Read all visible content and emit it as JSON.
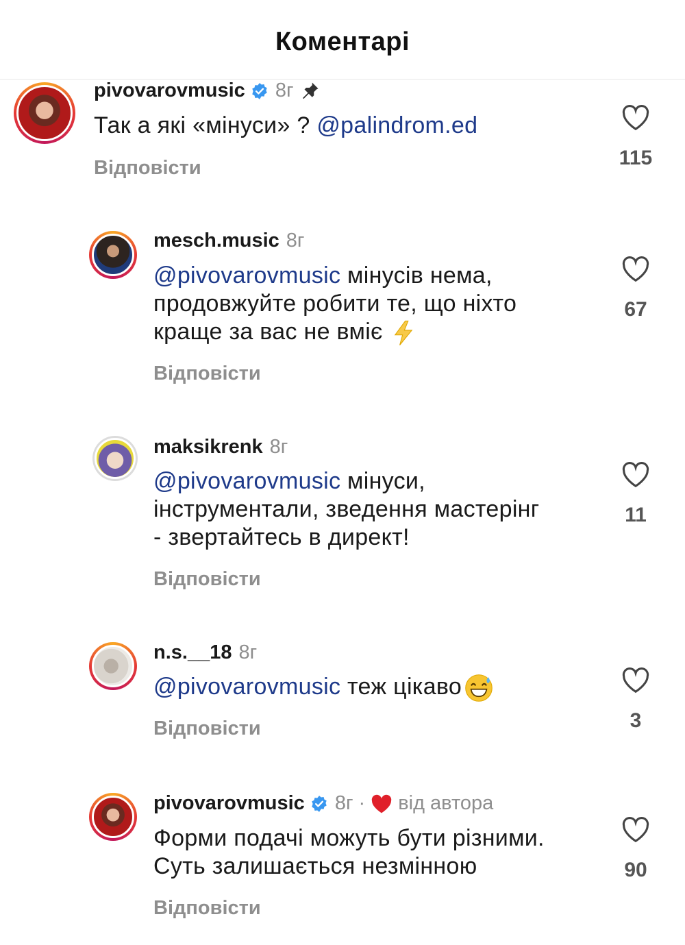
{
  "header": {
    "title": "Коментарі"
  },
  "comments": [
    {
      "username": "pivovarovmusic",
      "time": "8г",
      "mention": "@palindrom.ed",
      "text_before": "Так а які «мінуси» ? ",
      "reply_label": "Відповісти",
      "likes": "115",
      "pinned": true,
      "verified": true
    },
    {
      "username": "mesch.music",
      "time": "8г",
      "mention": "@pivovarovmusic",
      "text_line1": " мінусів нема,",
      "text_line2": "продовжуйте робити те, що ніхто",
      "text_line3": "краще за вас не вміє ",
      "emoji": "lightning-emoji",
      "reply_label": "Відповісти",
      "likes": "67"
    },
    {
      "username": "maksikrenk",
      "time": "8г",
      "mention": "@pivovarovmusic",
      "text_line1": " мінуси,",
      "text_line2": "інструментали, зведення мастерінг",
      "text_line3": "- звертайтесь в директ!",
      "reply_label": "Відповісти",
      "likes": "11"
    },
    {
      "username": "n.s.__18",
      "time": "8г",
      "mention": "@pivovarovmusic",
      "text_line1": " теж цікаво",
      "emoji": "grinning-sweat-emoji",
      "reply_label": "Відповісти",
      "likes": "3"
    },
    {
      "username": "pivovarovmusic",
      "time": "8г",
      "separator": "·",
      "by_author": "від автора",
      "text_line1": "Форми подачі можуть бути різними.",
      "text_line2": "Суть залишається незмінною",
      "reply_label": "Відповісти",
      "likes": "90",
      "verified": true
    }
  ],
  "colors": {
    "mention": "#1e3a8a",
    "verified": "#3897f0",
    "author_heart": "#e0202a",
    "muted": "#8e8e8e"
  }
}
